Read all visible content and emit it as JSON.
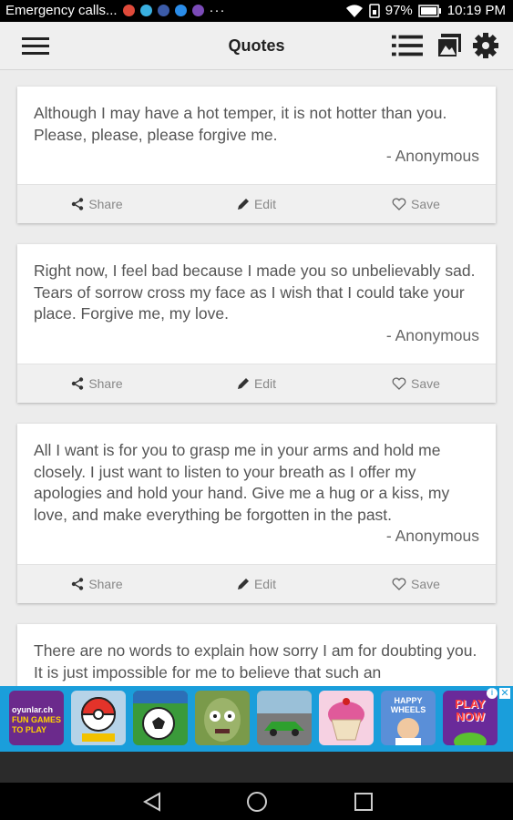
{
  "status_bar": {
    "notification_text": "Emergency calls...",
    "more_indicator": "···",
    "battery": "97%",
    "time": "10:19 PM"
  },
  "app_bar": {
    "title": "Quotes"
  },
  "actions": {
    "share": "Share",
    "edit": "Edit",
    "save": "Save"
  },
  "quotes": [
    {
      "text": "Although I may have a hot temper, it is not hotter than you. Please, please, please forgive me.",
      "author": "- Anonymous"
    },
    {
      "text": "Right now, I feel bad because I made you so unbelievably sad. Tears of sorrow cross my face as I wish that I could take your place. Forgive me, my love.",
      "author": "- Anonymous"
    },
    {
      "text": "All I want is for you to grasp me in your arms and hold me closely. I just want to listen to your breath as I offer my apologies and hold your hand. Give me a hug or a kiss, my love, and make everything be forgotten in the past.",
      "author": "- Anonymous"
    },
    {
      "text": "There are no words to explain how sorry I am for doubting you. It is just impossible for me to believe that such an",
      "author": ""
    }
  ],
  "ad": {
    "tiles": [
      {
        "label": "oyunlar.ch FUN GAMES TO PLAY",
        "color": "#6b2a8c"
      },
      {
        "label": "Pokemon",
        "color": "#d93a2b"
      },
      {
        "label": "Soccer",
        "color": "#2f8f2f"
      },
      {
        "label": "Zombies",
        "color": "#6b8f3a"
      },
      {
        "label": "Racing",
        "color": "#3a7a3a"
      },
      {
        "label": "Cupcake",
        "color": "#e07aa8"
      },
      {
        "label": "HAPPY WHEELS",
        "color": "#5a8fd8"
      },
      {
        "label": "PLAY NOW",
        "color": "#1a9edb"
      }
    ]
  },
  "colors": {
    "status_bg": "#000000",
    "appbar_bg": "#efefef",
    "content_bg": "#ececec",
    "action_bg": "#f0f0f0",
    "ad_bg": "#1a9edb"
  }
}
